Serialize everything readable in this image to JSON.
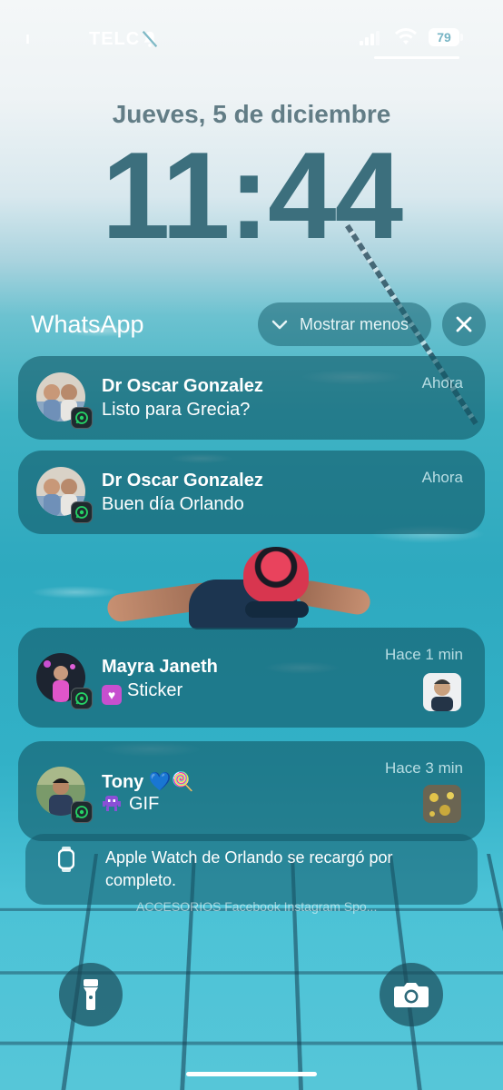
{
  "status_bar": {
    "left_glyph": "ı",
    "carrier": "TELC",
    "battery": "79"
  },
  "lock_screen": {
    "date": "Jueves, 5 de diciembre",
    "time": "11:44"
  },
  "group": {
    "title": "WhatsApp",
    "show_less_label": "Mostrar menos"
  },
  "notifications": [
    {
      "sender": "Dr Oscar Gonzalez",
      "message": "Listo para Grecia?",
      "time": "Ahora"
    },
    {
      "sender": "Dr Oscar Gonzalez",
      "message": "Buen día Orlando",
      "time": "Ahora"
    },
    {
      "sender": "Mayra Janeth",
      "message": "Sticker",
      "time": "Hace 1 min"
    },
    {
      "sender": "Tony 💙🍭",
      "message": "GIF",
      "time": "Hace 3 min"
    }
  ],
  "watch_notification": {
    "text": "Apple Watch de Orlando se recargó por completo."
  },
  "background_notification_peek": "ACCESORIOS Facebook Instagram Spo...",
  "icons": {
    "flashlight": "flashlight-icon",
    "camera": "camera-icon",
    "close": "close-icon",
    "chevron": "chevron-down-icon",
    "app_badge": "whatsapp-icon"
  }
}
